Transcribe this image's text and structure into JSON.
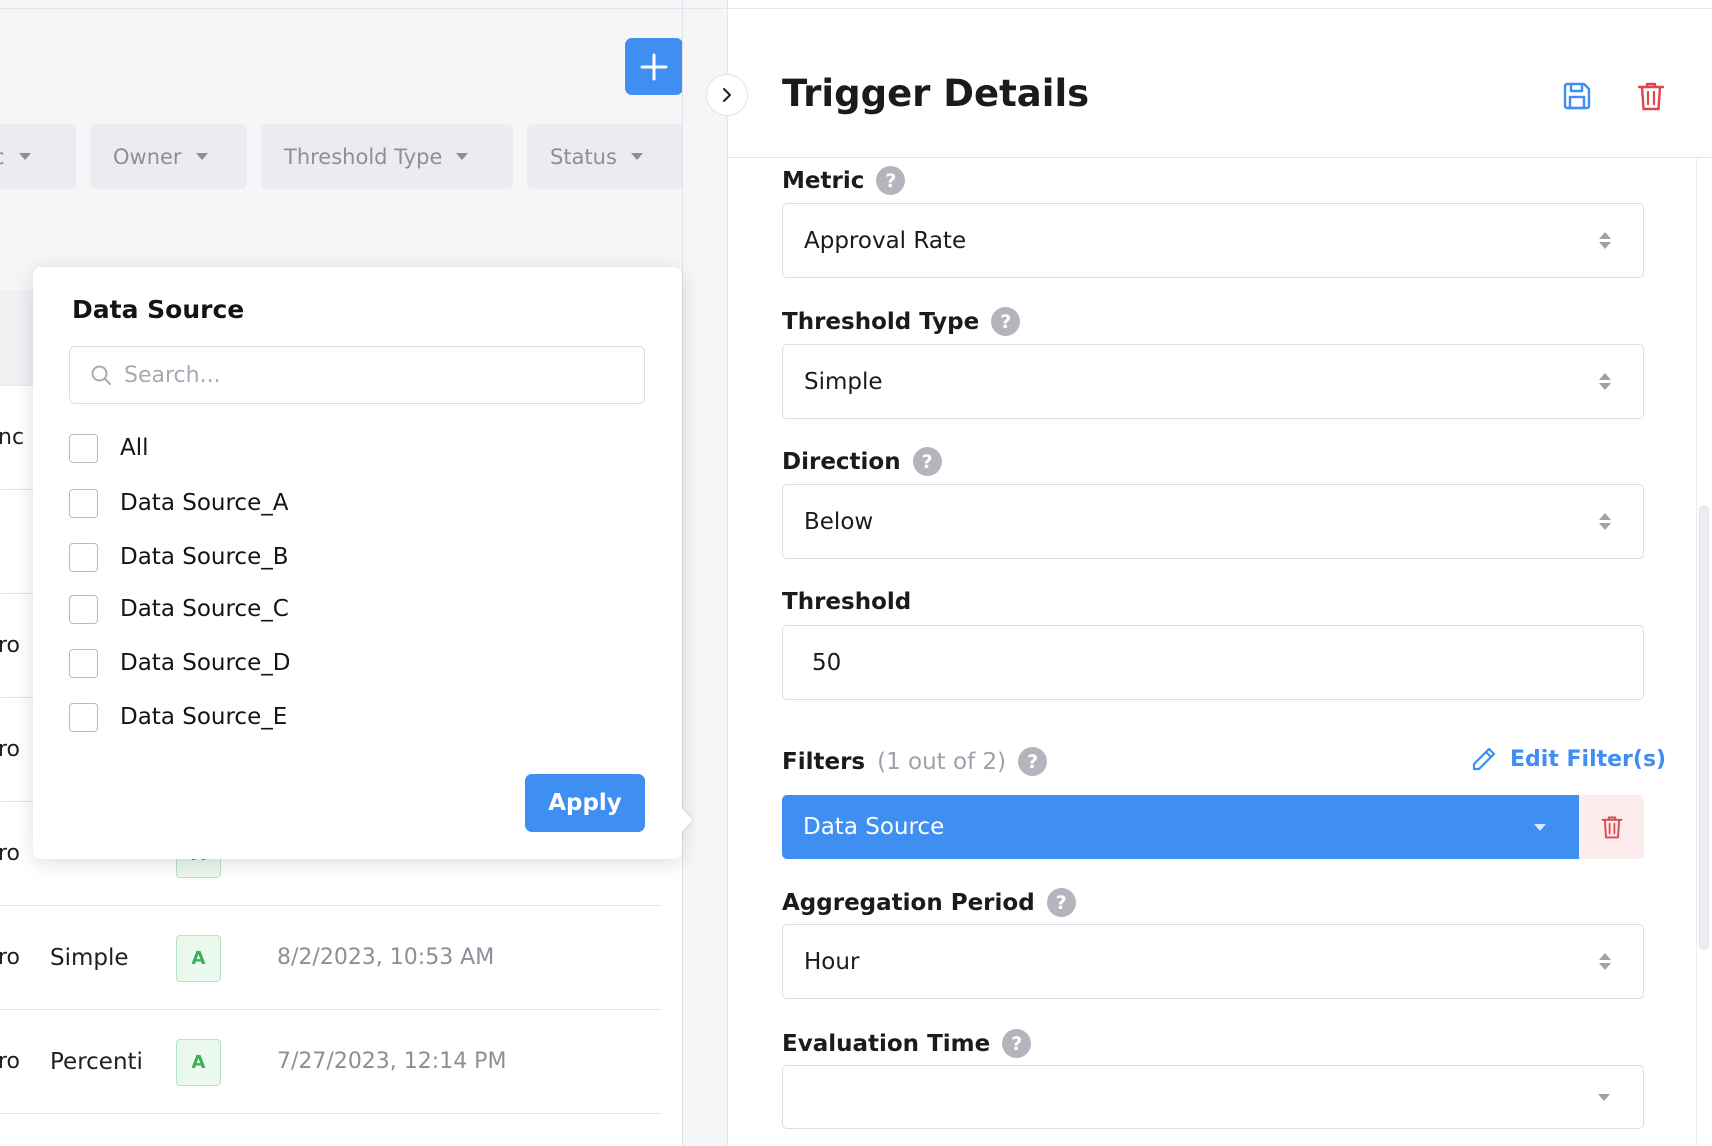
{
  "left_panel": {
    "filter_chips": [
      {
        "label": "c"
      },
      {
        "label": "Owner"
      },
      {
        "label": "Threshold Type"
      },
      {
        "label": "Status"
      }
    ],
    "partial_row_texts": [
      "nc",
      "ro",
      "ro",
      "ro"
    ],
    "rows": [
      {
        "col0": "ro",
        "threshold_type": "Simple",
        "status": "A",
        "updated": "8/2/2023, 10:53 AM"
      },
      {
        "col0": "ro",
        "threshold_type": "Percenti",
        "status": "A",
        "updated": "7/27/2023, 12:14 PM"
      }
    ],
    "partial_row_badge": "A"
  },
  "popup": {
    "title": "Data Source",
    "search_placeholder": "Search...",
    "options": [
      "All",
      "Data Source_A",
      "Data Source_B",
      "Data Source_C",
      "Data Source_D",
      "Data Source_E"
    ],
    "apply_label": "Apply"
  },
  "trigger_details": {
    "title": "Trigger Details",
    "metric": {
      "label": "Metric",
      "value": "Approval Rate"
    },
    "threshold_type": {
      "label": "Threshold Type",
      "value": "Simple"
    },
    "direction": {
      "label": "Direction",
      "value": "Below"
    },
    "threshold": {
      "label": "Threshold",
      "value": "50"
    },
    "filters": {
      "label": "Filters",
      "count_text": "(1 out of 2)",
      "edit_label": "Edit Filter(s)",
      "selected": "Data Source"
    },
    "aggregation_period": {
      "label": "Aggregation Period",
      "value": "Hour"
    },
    "evaluation_time": {
      "label": "Evaluation Time",
      "value": ""
    },
    "help_glyph": "?"
  },
  "colors": {
    "accent": "#3f8ef2",
    "danger": "#e0474c",
    "success": "#36b15a"
  }
}
